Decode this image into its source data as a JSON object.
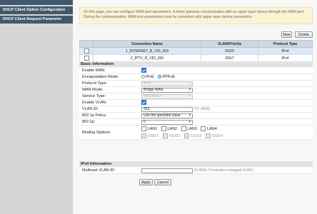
{
  "sidebar": {
    "items": [
      {
        "label": ""
      },
      {
        "label": "DHCP Client Option Configuration"
      },
      {
        "label": "DHCP Client Request Parameter"
      }
    ]
  },
  "notice": "On this page, you can configure WAN port parameters. A home gateway communicates with an upper-layer device through the WAN port. During the communication, WAN port parameters must be consistent with upper-layer device parameters.",
  "toolbar": {
    "new_label": "New",
    "delete_label": "Delete"
  },
  "connections": {
    "headers": [
      "",
      "Connection Name",
      "VLAN/Priority",
      "Protocol Type"
    ],
    "rows": [
      {
        "name": "1_INTERNET_B_VID_263",
        "vlan": "263/0",
        "protocol": "IPv4"
      },
      {
        "name": "2_IPTV_R_VID_266",
        "vlan": "266/7",
        "protocol": "IPv4"
      }
    ]
  },
  "basic": {
    "title": "Basic Information",
    "enable_wan_label": "Enable WAN:",
    "encap_label": "Encapsulation Mode:",
    "encap_opt1": "IPoE",
    "encap_opt2": "PPPoE",
    "protocol_label": "Protocol Type:",
    "protocol_value": "IPv4",
    "wan_mode_label": "WAN Mode:",
    "wan_mode_value": "Bridge WAN",
    "service_label": "Service Type:",
    "service_value": "INTERNET",
    "enable_vlan_label": "Enable VLAN:",
    "vlan_id_label": "VLAN ID:",
    "vlan_id_value": "263",
    "vlan_id_hint": "*(1~4094)",
    "policy_label": "802.1p Policy:",
    "policy_value": "Use the specified value",
    "p8021_label": "802.1p:",
    "p8021_value": "0",
    "binding_label": "Binding Options:",
    "lan": [
      "LAN1",
      "LAN2",
      "LAN3",
      "LAN4"
    ],
    "ssid": [
      "SSID1",
      "SSID2",
      "SSID3",
      "SSID4"
    ]
  },
  "ipv4": {
    "title": "IPv4 Information",
    "mvlan_label": "Multicast VLAN ID:",
    "mvlan_value": "",
    "mvlan_hint": "(0-4094; 0 indicates untagged VLAN.)"
  },
  "actions": {
    "apply_label": "Apply",
    "cancel_label": "Cancel"
  }
}
